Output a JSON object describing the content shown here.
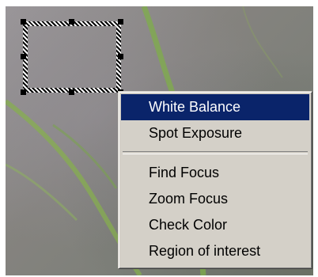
{
  "context_menu": {
    "items_group_1": [
      {
        "label": "White Balance",
        "selected": true
      },
      {
        "label": "Spot Exposure",
        "selected": false
      }
    ],
    "items_group_2": [
      {
        "label": "Find Focus",
        "selected": false
      },
      {
        "label": "Zoom Focus",
        "selected": false
      },
      {
        "label": "Check Color",
        "selected": false
      },
      {
        "label": "Region of interest",
        "selected": false
      }
    ]
  },
  "colors": {
    "menu_background": "#d4d0c8",
    "selection_highlight": "#0a246a",
    "selection_text": "#ffffff"
  }
}
